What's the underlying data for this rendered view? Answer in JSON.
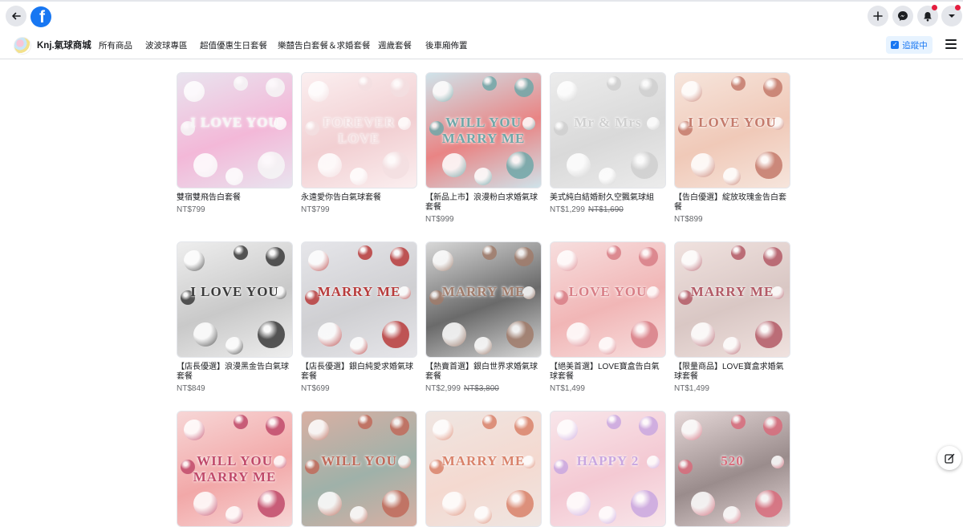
{
  "topbar": {
    "back_icon": "arrow-left-icon",
    "logo_letter": "f",
    "actions": [
      "plus-icon",
      "messenger-icon",
      "bell-icon",
      "account-chevron-icon"
    ]
  },
  "shop": {
    "name": "Knj.氣球商城",
    "nav": [
      "所有商品",
      "波波球專區",
      "超值優惠生日套餐",
      "樂囍告白套餐＆求婚套餐",
      "週歲套餐",
      "後車廂佈置"
    ],
    "follow_label": "追蹤中"
  },
  "products": [
    {
      "title": "雙宿雙飛告白套餐",
      "price": "NT$799",
      "original_price": "",
      "art": "I LOVE YOU",
      "colors": [
        "#f3b8d8",
        "#e9e4ef",
        "#f6f6f6"
      ]
    },
    {
      "title": "永遠愛你告白氣球套餐",
      "price": "NT$799",
      "original_price": "",
      "art": "FOREVER LOVE",
      "colors": [
        "#f2cfd2",
        "#fbeff0",
        "#f3dfe1"
      ]
    },
    {
      "title": "【新品上市】浪漫粉白求婚氣球套餐",
      "price": "NT$999",
      "original_price": "",
      "art": "WILL YOU MARRY ME",
      "colors": [
        "#e98484",
        "#cfe3ea",
        "#6fa7a8"
      ]
    },
    {
      "title": "美式純白結婚耐久空飄氣球組",
      "price": "NT$1,299",
      "original_price": "NT$1,690",
      "art": "Mr & Mrs",
      "colors": [
        "#d9d9d9",
        "#ececec",
        "#cfcfcf"
      ]
    },
    {
      "title": "【告白優選】綻放玫瑰金告白套餐",
      "price": "NT$899",
      "original_price": "",
      "art": "I LOVE YOU",
      "colors": [
        "#f0c9b8",
        "#f6e5dc",
        "#c47a6b"
      ]
    },
    {
      "title": "【店長優選】浪漫黑金告白氣球套餐",
      "price": "NT$849",
      "original_price": "",
      "art": "I LOVE YOU",
      "colors": [
        "#c9c9c9",
        "#eeeeee",
        "#3a3a3a"
      ]
    },
    {
      "title": "【店長優選】銀白純愛求婚氣球套餐",
      "price": "NT$699",
      "original_price": "",
      "art": "MARRY ME",
      "colors": [
        "#cfcfd2",
        "#e6e6ea",
        "#b83b3b"
      ]
    },
    {
      "title": "【熱賣首選】銀白世界求婚氣球套餐",
      "price": "NT$2,999",
      "original_price": "NT$3,800",
      "art": "MARRY ME",
      "colors": [
        "#6a6a6a",
        "#d8d8d8",
        "#a07b6a"
      ]
    },
    {
      "title": "【絕美首選】LOVE寶盒告白氣球套餐",
      "price": "NT$1,499",
      "original_price": "",
      "art": "LOVE YOU",
      "colors": [
        "#f1b6b6",
        "#f7dede",
        "#d87e86"
      ]
    },
    {
      "title": "【限量商品】LOVE寶盒求婚氣球套餐",
      "price": "NT$1,499",
      "original_price": "",
      "art": "MARRY ME",
      "colors": [
        "#d9c7c4",
        "#f0e2df",
        "#b35a66"
      ]
    },
    {
      "title": "",
      "price": "",
      "original_price": "",
      "art": "WILL YOU MARRY ME",
      "colors": [
        "#f2a8a8",
        "#f7d6d6",
        "#c04a6a"
      ]
    },
    {
      "title": "",
      "price": "",
      "original_price": "",
      "art": "WILL YOU",
      "colors": [
        "#9fb1a9",
        "#d9b0a3",
        "#c06a5a"
      ]
    },
    {
      "title": "",
      "price": "",
      "original_price": "",
      "art": "MARRY ME",
      "colors": [
        "#f4d9d0",
        "#efe6e2",
        "#d9826a"
      ]
    },
    {
      "title": "",
      "price": "",
      "original_price": "",
      "art": "HAPPY 2",
      "colors": [
        "#f4c9d3",
        "#f8e6ea",
        "#c9a7e0"
      ]
    },
    {
      "title": "",
      "price": "",
      "original_price": "",
      "art": "520",
      "colors": [
        "#9a8c8c",
        "#e5d7d7",
        "#d86b7b"
      ]
    }
  ],
  "fab_icon": "edit-compose-icon"
}
